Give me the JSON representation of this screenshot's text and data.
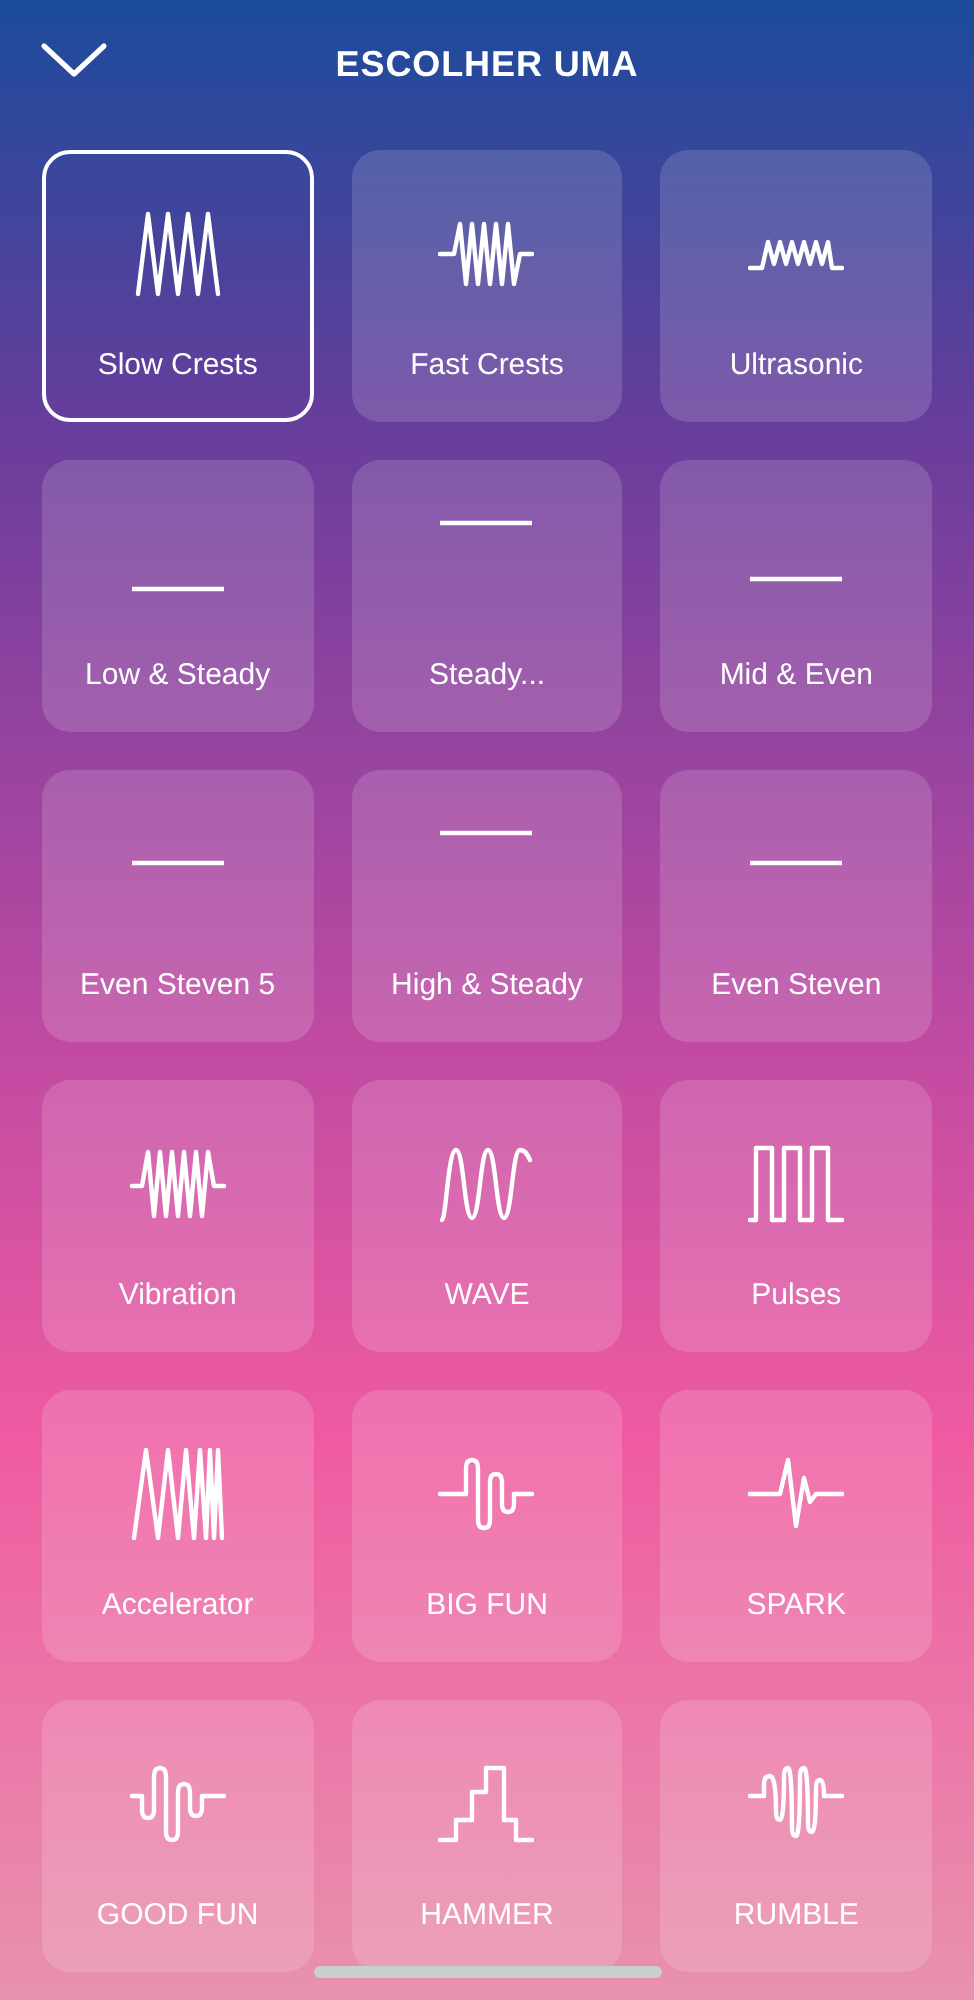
{
  "header": {
    "title": "ESCOLHER UMA"
  },
  "patterns": [
    {
      "label": "Slow Crests",
      "kind": "slow-crests",
      "selected": true
    },
    {
      "label": "Fast Crests",
      "kind": "fast-crests",
      "selected": false
    },
    {
      "label": "Ultrasonic",
      "kind": "ultrasonic",
      "selected": false
    },
    {
      "label": "Low & Steady",
      "kind": "line-bottom",
      "selected": false
    },
    {
      "label": "Steady...",
      "kind": "line-top",
      "selected": false
    },
    {
      "label": "Mid & Even",
      "kind": "line-low",
      "selected": false
    },
    {
      "label": "Even Steven 5",
      "kind": "line-middle",
      "selected": false
    },
    {
      "label": "High & Steady",
      "kind": "line-top",
      "selected": false
    },
    {
      "label": "Even Steven",
      "kind": "line-middle",
      "selected": false
    },
    {
      "label": "Vibration",
      "kind": "vibration",
      "selected": false
    },
    {
      "label": "WAVE",
      "kind": "sine",
      "selected": false
    },
    {
      "label": "Pulses",
      "kind": "square",
      "selected": false
    },
    {
      "label": "Accelerator",
      "kind": "accelerator",
      "selected": false
    },
    {
      "label": "BIG FUN",
      "kind": "big-fun",
      "selected": false
    },
    {
      "label": "SPARK",
      "kind": "spark",
      "selected": false
    },
    {
      "label": "GOOD FUN",
      "kind": "good-fun",
      "selected": false
    },
    {
      "label": "HAMMER",
      "kind": "steps",
      "selected": false
    },
    {
      "label": "RUMBLE",
      "kind": "rumble",
      "selected": false
    }
  ]
}
